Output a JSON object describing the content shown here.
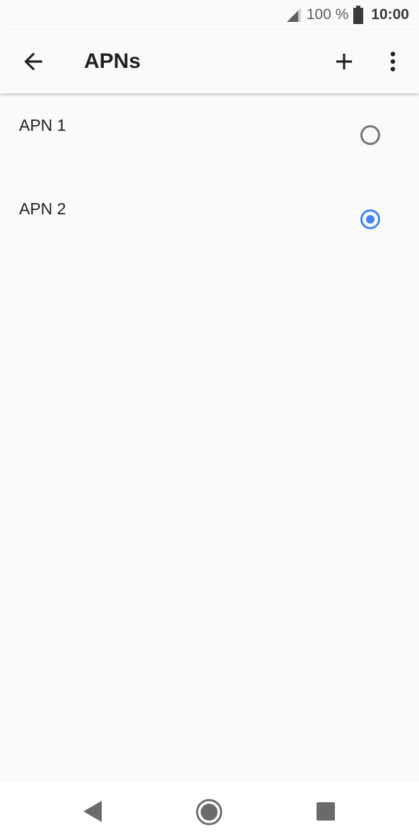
{
  "status_bar": {
    "battery": "100 %",
    "time": "10:00",
    "icons": [
      "signal-icon",
      "battery-icon"
    ]
  },
  "app_bar": {
    "title": "APNs",
    "icons": [
      "back-arrow-icon",
      "add-icon",
      "more-vert-icon"
    ]
  },
  "apns": [
    {
      "name": "APN 1",
      "selected": false
    },
    {
      "name": "APN 2",
      "selected": true
    }
  ],
  "nav_bar": {
    "icons": [
      "nav-back-icon",
      "nav-home-icon",
      "nav-recents-icon"
    ]
  },
  "colors": {
    "accent": "#4285f4",
    "background": "#fafafa",
    "text": "#212121"
  }
}
